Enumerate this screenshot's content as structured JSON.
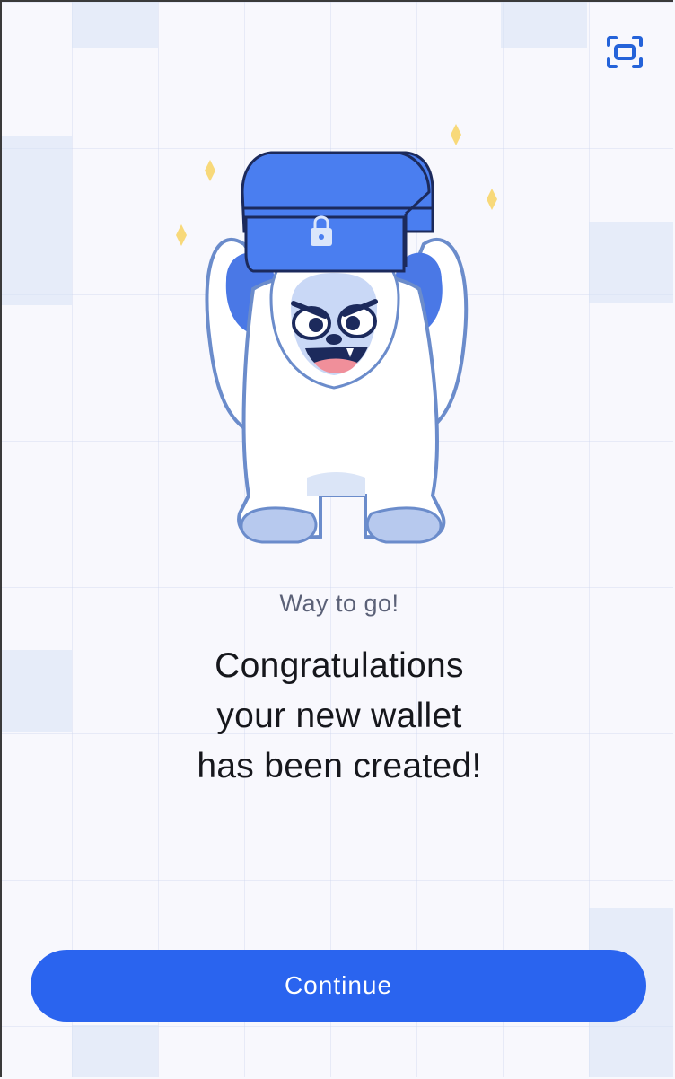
{
  "header": {
    "scan_icon": "scan-frame-icon"
  },
  "illustration": {
    "name": "yeti-holding-chest",
    "lock_icon": "lock-icon",
    "sparkle_icon": "sparkle-icon"
  },
  "message": {
    "subtitle": "Way to go!",
    "headline_lines": [
      "Congratulations",
      "your new wallet",
      "has been created!"
    ]
  },
  "actions": {
    "continue_label": "Continue"
  },
  "colors": {
    "accent": "#2a64ef",
    "background": "#f8f8fd",
    "headline_text": "#16171c",
    "subtitle_text": "#5b6177",
    "sparkle": "#f8d97a"
  }
}
